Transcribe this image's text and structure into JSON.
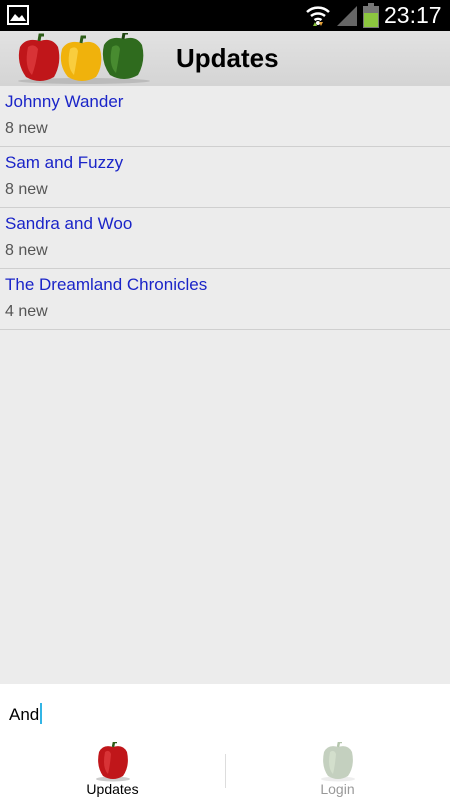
{
  "status_bar": {
    "time": "23:17",
    "icons": [
      "gallery-icon",
      "wifi-icon",
      "signal-icon",
      "battery-icon"
    ],
    "battery_color": "#8cc63f"
  },
  "action_bar": {
    "title": "Updates",
    "logo": "peppers-logo"
  },
  "updates": [
    {
      "title": "Johnny Wander",
      "count": "8 new"
    },
    {
      "title": "Sam and Fuzzy",
      "count": "8 new"
    },
    {
      "title": "Sandra and Woo",
      "count": "8 new"
    },
    {
      "title": "The Dreamland Chronicles",
      "count": "4 new"
    }
  ],
  "input": {
    "value": "And"
  },
  "tabs": [
    {
      "label": "Updates",
      "icon": "red-pepper-icon",
      "selected": true
    },
    {
      "label": "Login",
      "icon": "faded-pepper-icon",
      "selected": false
    }
  ],
  "colors": {
    "link": "#1a24c8",
    "background": "#ececec",
    "caret": "#33b5e5"
  }
}
